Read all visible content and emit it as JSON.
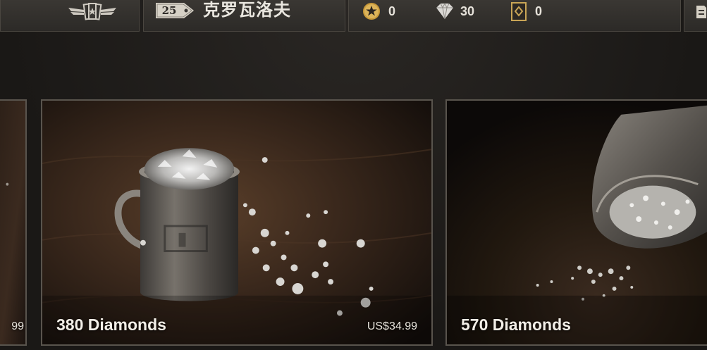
{
  "header": {
    "player_level": "25",
    "player_name": "克罗瓦洛夫",
    "currencies": [
      {
        "icon": "gold-star-coin-icon",
        "value": "0"
      },
      {
        "icon": "diamond-icon",
        "value": "30"
      },
      {
        "icon": "card-pack-icon",
        "value": "0"
      }
    ],
    "menu_icon": "menu-icon"
  },
  "offers": [
    {
      "title": "",
      "price": "99"
    },
    {
      "title": "380 Diamonds",
      "price": "US$34.99"
    },
    {
      "title": "570 Diamonds",
      "price": ""
    }
  ],
  "colors": {
    "bar_bg": "#2c2a27",
    "card_border": "#59544d",
    "gold": "#c99a3a",
    "text": "#e9e6df"
  }
}
